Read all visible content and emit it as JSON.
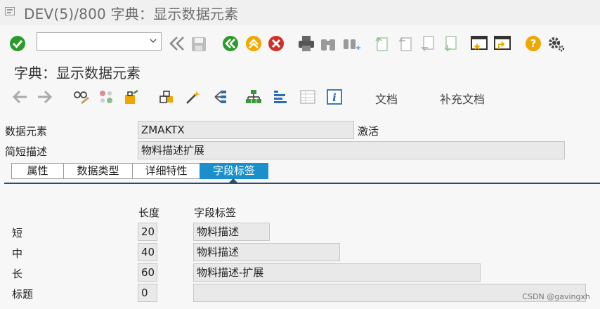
{
  "window": {
    "title": "DEV(5)/800 字典：显示数据元素"
  },
  "toolbar": {
    "command_value": ""
  },
  "screen": {
    "title": "字典：显示数据元素"
  },
  "app_toolbar": {
    "documentation": "文档",
    "supplementary_documentation": "补充文档"
  },
  "header": {
    "data_element_label": "数据元素",
    "data_element_value": "ZMAKTX",
    "status": "激活",
    "short_desc_label": "简短描述",
    "short_desc_value": "物料描述扩展"
  },
  "tabs": [
    {
      "label": "属性",
      "active": false
    },
    {
      "label": "数据类型",
      "active": false
    },
    {
      "label": "详细特性",
      "active": false
    },
    {
      "label": "字段标签",
      "active": true
    }
  ],
  "field_labels": {
    "col_length": "长度",
    "col_label": "字段标签",
    "rows": [
      {
        "name": "短",
        "length": "20",
        "text": "物料描述"
      },
      {
        "name": "中",
        "length": "40",
        "text": "物料描述"
      },
      {
        "name": "长",
        "length": "60",
        "text": "物料描述-扩展"
      },
      {
        "name": "标题",
        "length": "0",
        "text": ""
      }
    ]
  },
  "watermark": "CSDN @gavingxh",
  "colors": {
    "accent_tab": "#1a8fcc",
    "ok_green": "#2d9a2d",
    "cancel_red": "#d0302a",
    "nav_yellow": "#f0a800",
    "help_orange": "#f0a800"
  }
}
